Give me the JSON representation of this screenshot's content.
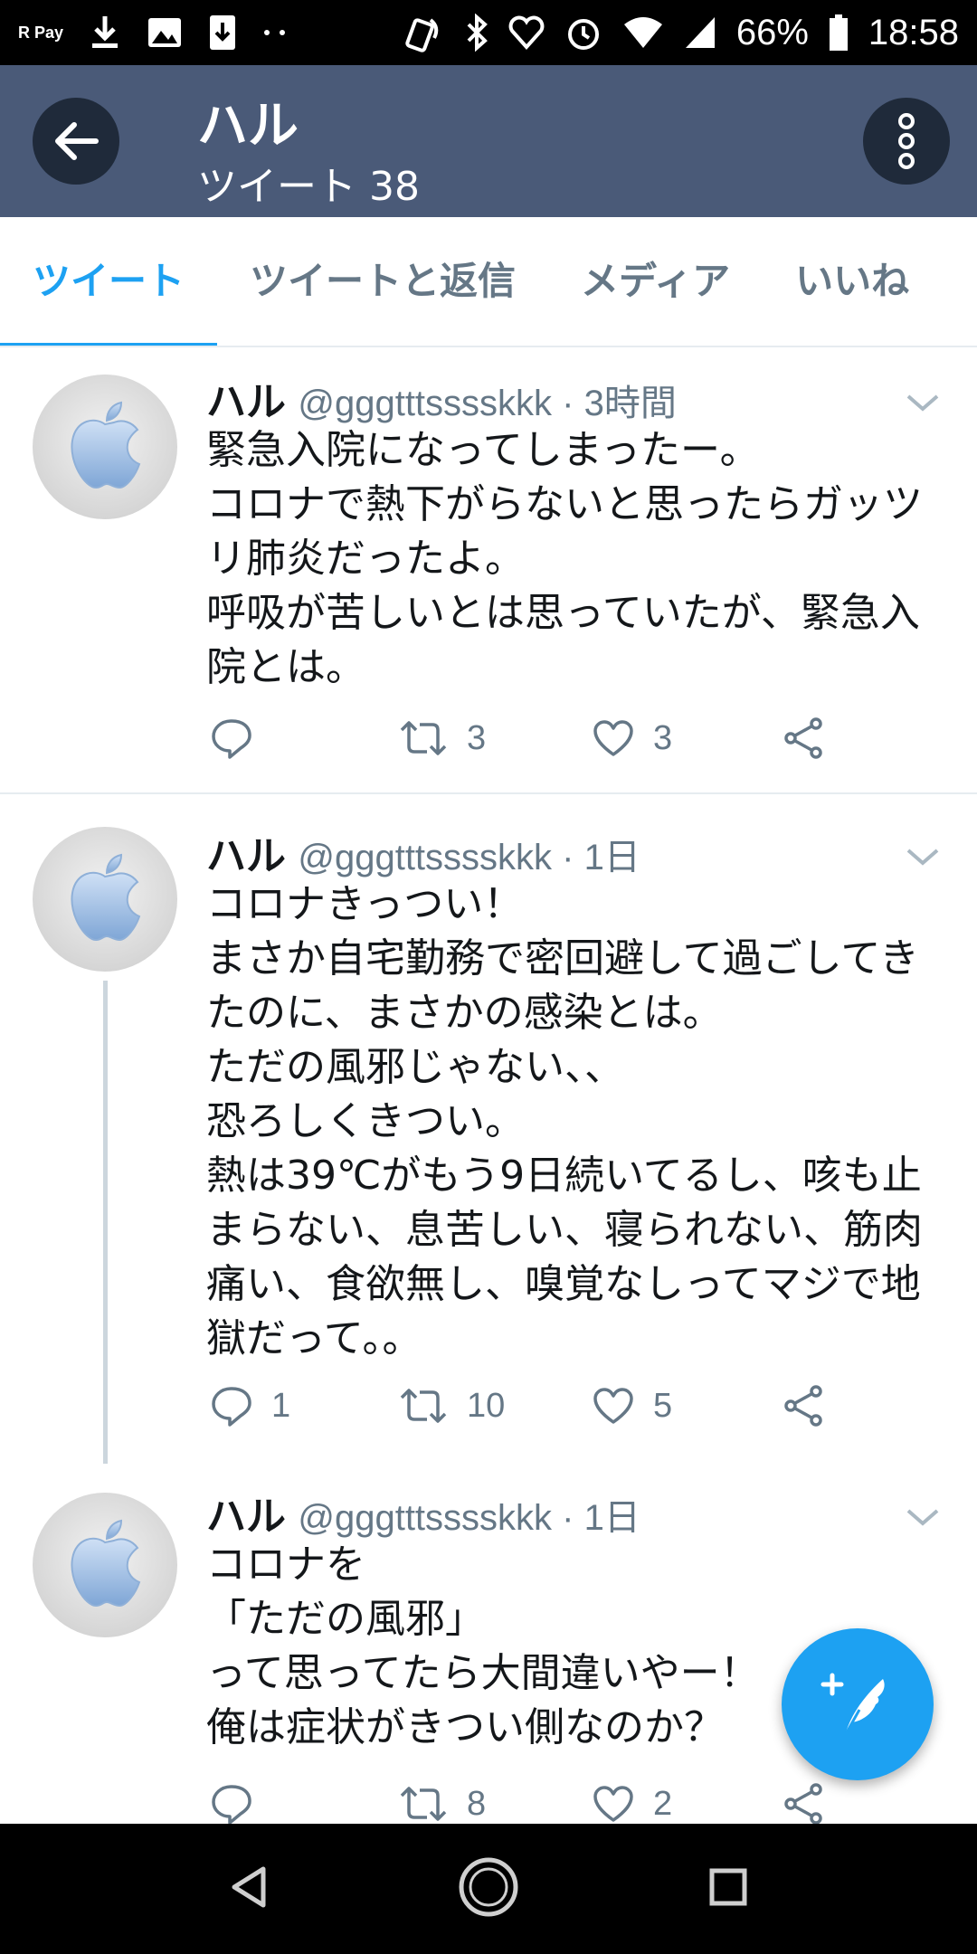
{
  "status_bar": {
    "pay_label": "R Pay",
    "battery": "66%",
    "time": "18:58"
  },
  "header": {
    "title": "ハル",
    "subtitle": "ツイート 38"
  },
  "tabs": [
    {
      "label": "ツイート",
      "active": true
    },
    {
      "label": "ツイートと返信",
      "active": false
    },
    {
      "label": "メディア",
      "active": false
    },
    {
      "label": "いいね",
      "active": false
    }
  ],
  "tweets": [
    {
      "name": "ハル",
      "meta": "@gggtttsssskkk · 3時間",
      "lines": [
        "緊急入院になってしまったー。",
        "コロナで熱下がらないと思ったらガッツ",
        "リ肺炎だったよ。",
        "呼吸が苦しいとは思っていたが、緊急入",
        "院とは。"
      ],
      "reply_count": "",
      "retweet_count": "3",
      "like_count": "3"
    },
    {
      "name": "ハル",
      "meta": "@gggtttsssskkk · 1日",
      "lines": [
        "コロナきっつい！",
        "まさか自宅勤務で密回避して過ごしてき",
        "たのに、まさかの感染とは。",
        "ただの風邪じゃない、、",
        "恐ろしくきつい。",
        "熱は39℃がもう9日続いてるし、咳も止",
        "まらない、息苦しい、寝られない、筋肉",
        "痛い、食欲無し、嗅覚なしってマジで地",
        "獄だって。。"
      ],
      "reply_count": "1",
      "retweet_count": "10",
      "like_count": "5"
    },
    {
      "name": "ハル",
      "meta": "@gggtttsssskkk · 1日",
      "lines": [
        "コロナを",
        "「ただの風邪」",
        "って思ってたら大間違いやー！",
        "俺は症状がきつい側なのか？"
      ],
      "reply_count": "",
      "retweet_count": "8",
      "like_count": "2"
    }
  ],
  "icons": {
    "back": "arrow-left-icon",
    "more": "more-vertical-icon",
    "reply": "reply-icon",
    "retweet": "retweet-icon",
    "like": "heart-icon",
    "share": "share-icon",
    "compose": "compose-tweet-icon"
  },
  "colors": {
    "accent": "#1da1f2",
    "header_bg": "#4a5a78",
    "muted": "#657786"
  }
}
